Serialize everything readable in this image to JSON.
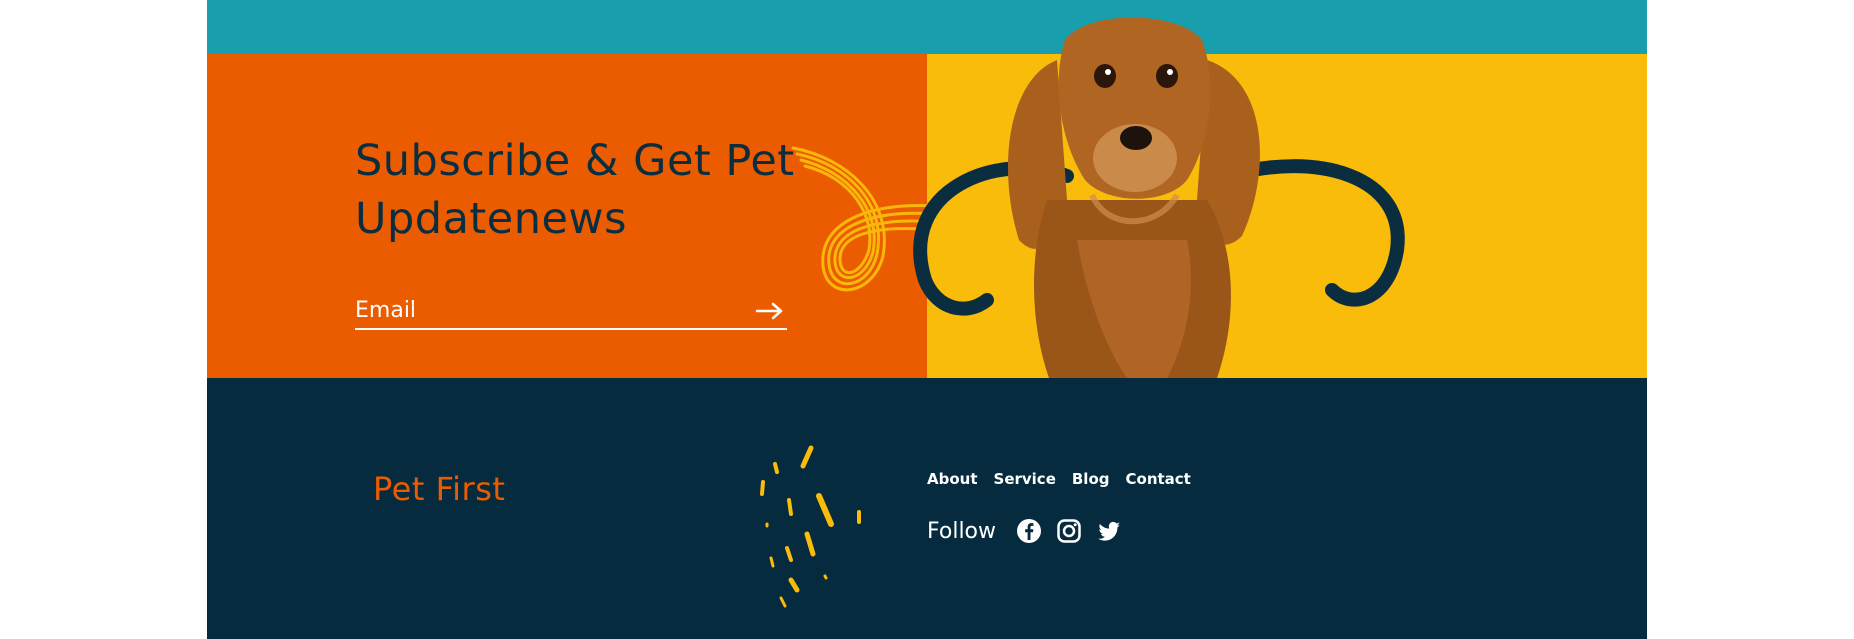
{
  "subscribe": {
    "title_line1": "Subscribe & Get Pet",
    "title_line2": "Updatenews",
    "email_placeholder": "Email"
  },
  "footer": {
    "brand": "Pet First",
    "nav": [
      "About",
      "Service",
      "Blog",
      "Contact"
    ],
    "follow_label": "Follow",
    "social_icons": [
      "facebook-icon",
      "instagram-icon",
      "twitter-icon"
    ]
  },
  "colors": {
    "teal": "#189ead",
    "orange": "#eb5c00",
    "yellow": "#f9bc0b",
    "navy": "#062b3e",
    "white": "#ffffff"
  }
}
